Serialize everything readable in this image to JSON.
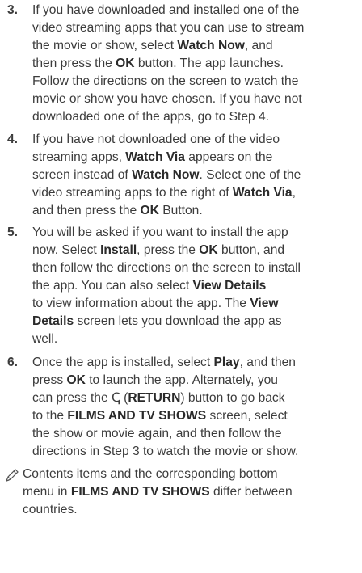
{
  "steps": [
    {
      "number": "3.",
      "lines": [
        [
          {
            "t": "If you have downloaded and installed one of the"
          }
        ],
        [
          {
            "t": "video streaming apps that you can use to stream"
          }
        ],
        [
          {
            "t": "the movie or show, select "
          },
          {
            "t": "Watch Now",
            "b": true
          },
          {
            "t": ", and"
          }
        ],
        [
          {
            "t": "then press the "
          },
          {
            "t": "OK",
            "b": true
          },
          {
            "t": " button. The app launches."
          }
        ],
        [
          {
            "t": "Follow the directions on the screen to watch the"
          }
        ],
        [
          {
            "t": "movie or show you have chosen. If you have not"
          }
        ],
        [
          {
            "t": "downloaded one of the apps, go to Step 4."
          }
        ]
      ]
    },
    {
      "number": "4.",
      "lines": [
        [
          {
            "t": "If you have not downloaded one of the video"
          }
        ],
        [
          {
            "t": "streaming apps, "
          },
          {
            "t": "Watch Via",
            "b": true
          },
          {
            "t": " appears on the"
          }
        ],
        [
          {
            "t": "screen instead of "
          },
          {
            "t": "Watch Now",
            "b": true
          },
          {
            "t": ". Select one of the"
          }
        ],
        [
          {
            "t": "video streaming apps to the right of "
          },
          {
            "t": "Watch Via",
            "b": true
          },
          {
            "t": ","
          }
        ],
        [
          {
            "t": "and then press the "
          },
          {
            "t": "OK",
            "b": true
          },
          {
            "t": " Button."
          }
        ]
      ]
    },
    {
      "number": "5.",
      "lines": [
        [
          {
            "t": "You will be asked if you want to install the app"
          }
        ],
        [
          {
            "t": "now. Select "
          },
          {
            "t": "Install",
            "b": true
          },
          {
            "t": ", press the "
          },
          {
            "t": "OK",
            "b": true
          },
          {
            "t": " button, and"
          }
        ],
        [
          {
            "t": "then follow the directions on the screen to install"
          }
        ],
        [
          {
            "t": "the app. You can also select "
          },
          {
            "t": "View Details",
            "b": true
          }
        ],
        [
          {
            "t": "to view information about the app. The "
          },
          {
            "t": "View",
            "b": true
          }
        ],
        [
          {
            "t": "Details",
            "b": true
          },
          {
            "t": " screen lets you download the app as"
          }
        ],
        [
          {
            "t": "well."
          }
        ]
      ]
    },
    {
      "number": "6.",
      "lines": [
        [
          {
            "t": "Once the app is installed, select "
          },
          {
            "t": "Play",
            "b": true
          },
          {
            "t": ", and then"
          }
        ],
        [
          {
            "t": "press "
          },
          {
            "t": "OK",
            "b": true
          },
          {
            "t": " to launch the app. Alternately, you"
          }
        ],
        [
          {
            "t": "can press the "
          },
          {
            "t": "ↅ",
            "b": false
          },
          {
            "t": " ("
          },
          {
            "t": "RETURN",
            "b": true
          },
          {
            "t": ") button to go back"
          }
        ],
        [
          {
            "t": "to the "
          },
          {
            "t": "FILMS AND TV SHOWS",
            "b": true
          },
          {
            "t": " screen, select"
          }
        ],
        [
          {
            "t": "the show or movie again, and then follow the"
          }
        ],
        [
          {
            "t": "directions in Step 3 to watch the movie or show."
          }
        ]
      ]
    }
  ],
  "note": {
    "icon": "note-pencil-icon",
    "lines": [
      [
        {
          "t": "Contents items and the corresponding bottom"
        }
      ],
      [
        {
          "t": "menu in "
        },
        {
          "t": "FILMS AND TV SHOWS",
          "b": true
        },
        {
          "t": " differ between"
        }
      ],
      [
        {
          "t": "countries."
        }
      ]
    ]
  }
}
